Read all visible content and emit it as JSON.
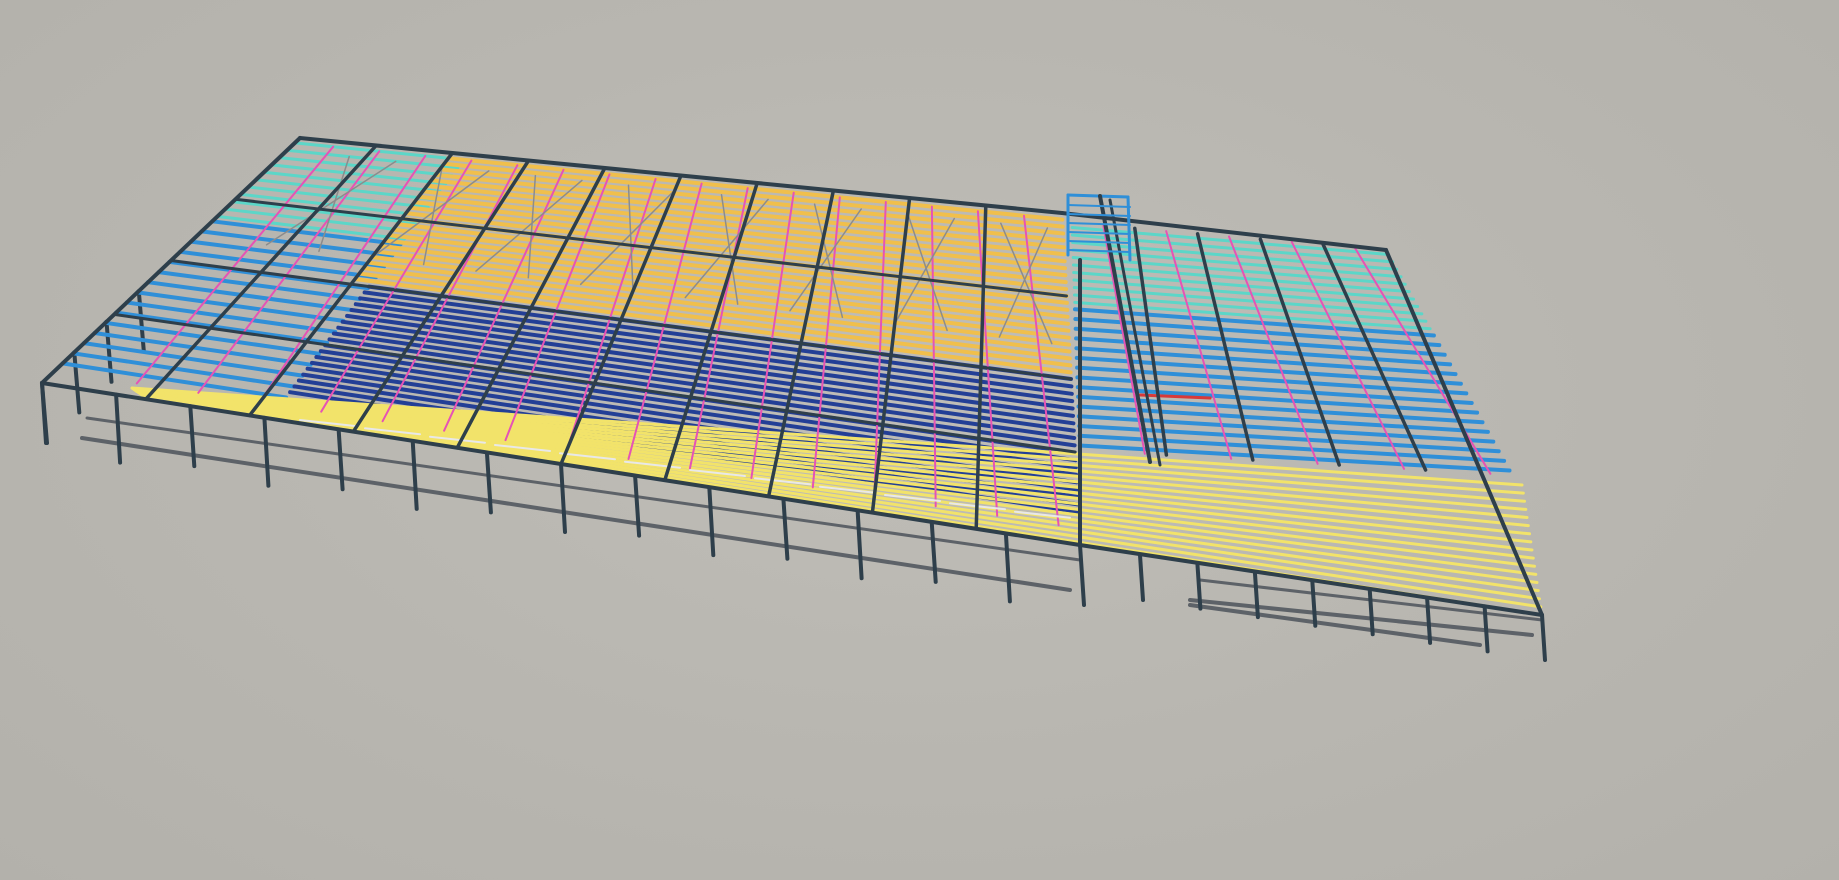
{
  "viewer": {
    "model": "steel-frame-structure",
    "background_color": "#b8b6b0"
  },
  "members": {
    "frame_color": "#2e3f4b",
    "roof_cyan_color": "#5cd6c8",
    "roof_blue_color": "#2f8fd8",
    "roof_orange_color": "#f0bf4c",
    "roof_navy_color": "#233f96",
    "roof_yellow_color": "#f2e36a",
    "bracing_magenta_color": "#e653b5",
    "bracing_grey_color": "#8c8c8c",
    "ground_tie_color": "#5d6268",
    "tie_white_color": "#e8e8e8",
    "accent_red_color": "#d83a3a"
  }
}
